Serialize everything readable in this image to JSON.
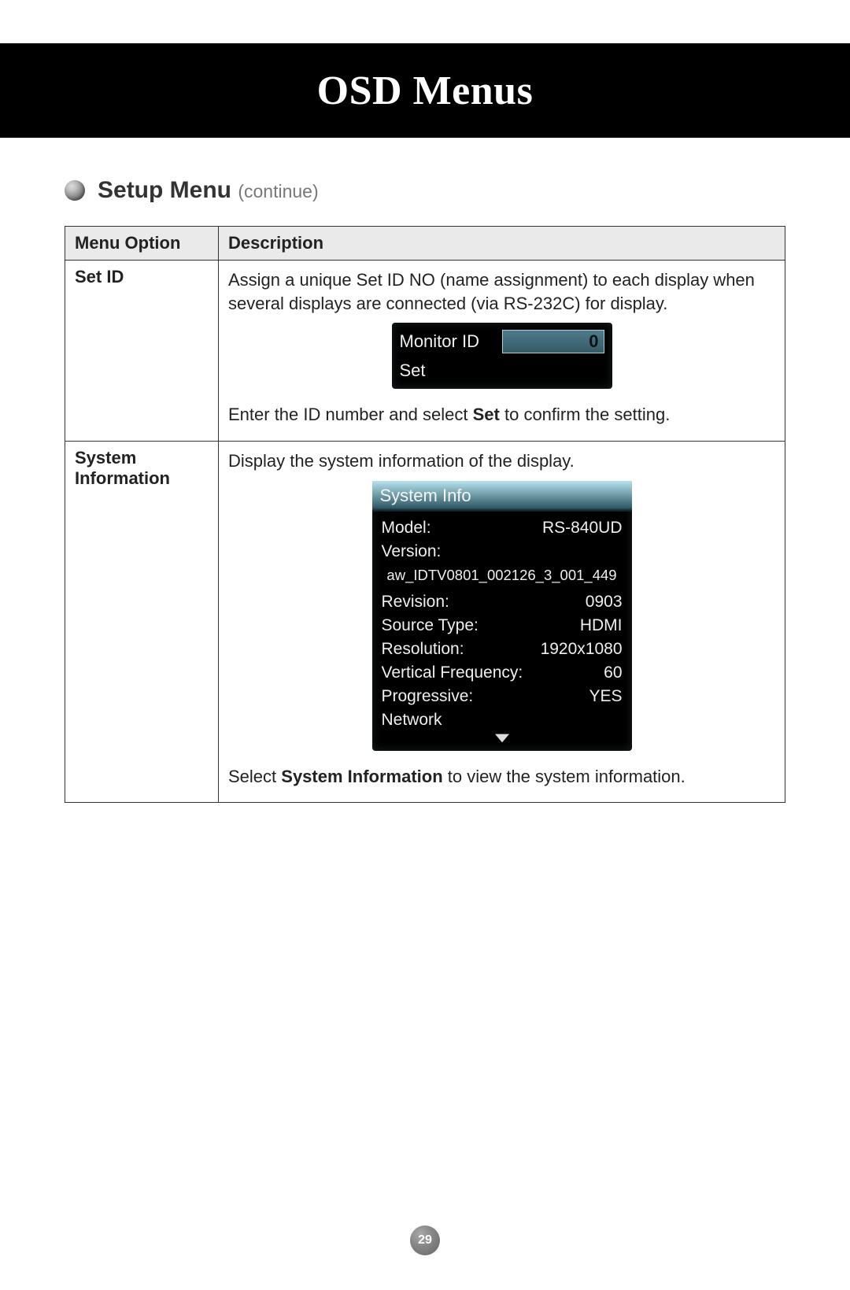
{
  "header": {
    "title": "OSD Menus"
  },
  "section": {
    "title_bold": "Setup Menu",
    "title_suffix": "(continue)"
  },
  "table": {
    "headers": {
      "option": "Menu Option",
      "description": "Description"
    },
    "rows": [
      {
        "option": "Set ID",
        "desc_before": "Assign a unique Set ID NO (name assignment) to each display when several displays are connected (via RS-232C) for display.",
        "osd": {
          "monitor_label": "Monitor ID",
          "monitor_value": "0",
          "set_label": "Set"
        },
        "desc_after_pre": "Enter the ID number and select ",
        "desc_after_bold": "Set",
        "desc_after_post": " to confirm the setting."
      },
      {
        "option": "System Information",
        "desc_before": "Display the system information of the display.",
        "osd": {
          "title": "System Info",
          "fields": {
            "model_label": "Model:",
            "model_value": "RS-840UD",
            "version_label": "Version:",
            "version_value": "aw_IDTV0801_002126_3_001_449",
            "revision_label": "Revision:",
            "revision_value": "0903",
            "source_label": "Source Type:",
            "source_value": "HDMI",
            "resolution_label": "Resolution:",
            "resolution_value": "1920x1080",
            "vfreq_label": "Vertical Frequency:",
            "vfreq_value": "60",
            "progressive_label": "Progressive:",
            "progressive_value": "YES",
            "network_label": "Network"
          }
        },
        "desc_after_pre": "Select ",
        "desc_after_bold": "System Information",
        "desc_after_post": " to view the system information."
      }
    ]
  },
  "page_number": "29"
}
